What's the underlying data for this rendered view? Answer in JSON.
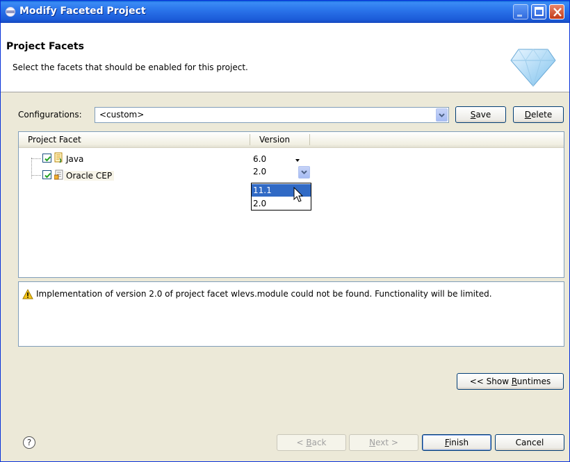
{
  "window": {
    "title": "Modify Faceted Project"
  },
  "header": {
    "title": "Project Facets",
    "description": "Select the facets that should be enabled for this project."
  },
  "configurations": {
    "label": "Configurations:",
    "value": "<custom>",
    "save_label_pre": "",
    "save_label_mnemonic": "S",
    "save_label_post": "ave",
    "delete_label_pre": "",
    "delete_label_mnemonic": "D",
    "delete_label_post": "elete"
  },
  "table": {
    "columns": [
      "Project Facet",
      "Version"
    ],
    "rows": [
      {
        "name": "Java",
        "version": "6.0",
        "checked": true,
        "icon": "java-facet-icon"
      },
      {
        "name": "Oracle CEP",
        "version": "2.0",
        "checked": true,
        "icon": "oracle-cep-facet-icon"
      }
    ],
    "version_dropdown": {
      "selected": "2.0",
      "options": [
        "11.1",
        "2.0"
      ],
      "highlighted": "11.1"
    }
  },
  "message": {
    "icon": "warning-icon",
    "text": "Implementation of version 2.0 of project facet wlevs.module could not be found. Functionality will be limited."
  },
  "runtimes_button": {
    "pre": "<< Show ",
    "mnemonic": "R",
    "post": "untimes"
  },
  "footer": {
    "help_icon": "help-icon",
    "back_pre": "< ",
    "back_mnemonic": "B",
    "back_post": "ack",
    "next_pre": "",
    "next_mnemonic": "N",
    "next_post": "ext >",
    "finish_pre": "",
    "finish_mnemonic": "F",
    "finish_post": "inish",
    "cancel_label": "Cancel"
  },
  "colors": {
    "titlebar": "#2b75eb",
    "dialog_bg": "#ece9d8",
    "selection": "#316ac5"
  }
}
